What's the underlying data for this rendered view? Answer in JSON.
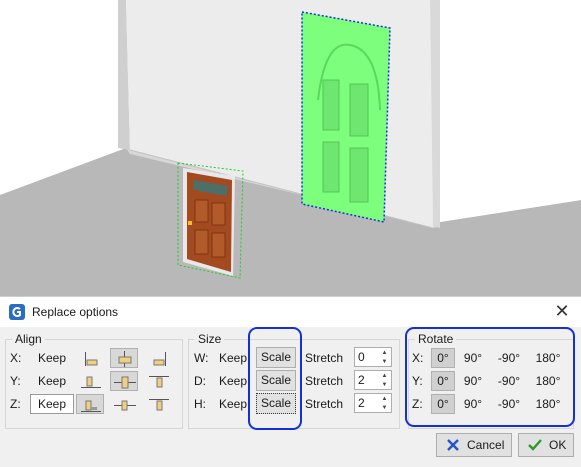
{
  "dialog": {
    "title": "Replace options",
    "close_icon": "close-icon",
    "app_icon": "app-logo-icon"
  },
  "align": {
    "legend": "Align",
    "rows": [
      {
        "axis": "X:",
        "keep": "Keep",
        "keep_selected": false,
        "selected_option": 1
      },
      {
        "axis": "Y:",
        "keep": "Keep",
        "keep_selected": false,
        "selected_option": 1
      },
      {
        "axis": "Z:",
        "keep": "Keep",
        "keep_selected": true,
        "selected_option": 0
      }
    ]
  },
  "size": {
    "legend": "Size",
    "rows": [
      {
        "axis": "W:",
        "keep": "Keep",
        "scale": "Scale",
        "stretch": "Stretch",
        "value": "0"
      },
      {
        "axis": "D:",
        "keep": "Keep",
        "scale": "Scale",
        "stretch": "Stretch",
        "value": "2"
      },
      {
        "axis": "H:",
        "keep": "Keep",
        "scale": "Scale",
        "stretch": "Stretch",
        "value": "2"
      }
    ]
  },
  "rotate": {
    "legend": "Rotate",
    "options": [
      "0°",
      "90°",
      "-90°",
      "180°"
    ],
    "rows": [
      {
        "axis": "X:",
        "selected": 0
      },
      {
        "axis": "Y:",
        "selected": 0
      },
      {
        "axis": "Z:",
        "selected": 0
      }
    ]
  },
  "buttons": {
    "cancel": "Cancel",
    "ok": "OK"
  },
  "colors": {
    "highlight": "#1530d8",
    "door_ghost": "#7dff7d",
    "door_wood": "#a0461e",
    "wall": "#ececec",
    "floor": "#b7b7b7"
  }
}
